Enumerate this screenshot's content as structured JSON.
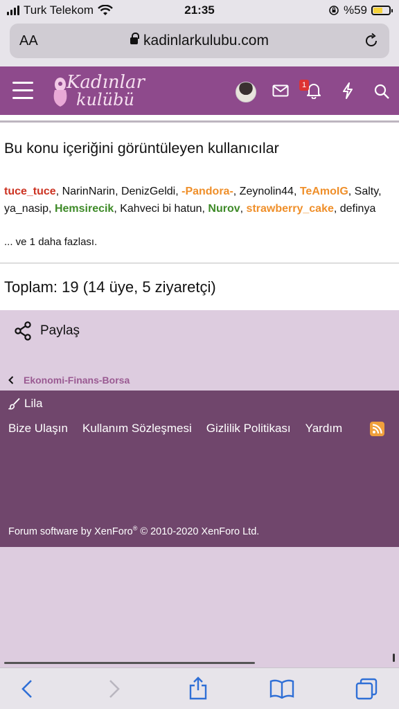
{
  "status_bar": {
    "carrier": "Turk Telekom",
    "time": "21:35",
    "battery": "%59"
  },
  "browser": {
    "aa_label": "AA",
    "url": "kadinlarkulubu.com"
  },
  "header": {
    "logo_line1": "Kadınlar",
    "logo_line2": "kulübü",
    "notification_count": "1"
  },
  "viewers": {
    "title": "Bu konu içeriğini görüntüleyen kullanıcılar",
    "users": [
      {
        "name": "tuce_tuce",
        "style": "red"
      },
      {
        "name": "NarinNarin",
        "style": "normal"
      },
      {
        "name": "DenizGeldi",
        "style": "normal"
      },
      {
        "name": "-Pandora-",
        "style": "orange"
      },
      {
        "name": "Zeynolin44",
        "style": "normal"
      },
      {
        "name": "TeAmoIG",
        "style": "orange"
      },
      {
        "name": "Salty",
        "style": "normal"
      },
      {
        "name": "ya_nasip",
        "style": "normal"
      },
      {
        "name": "Hemsirecik",
        "style": "green"
      },
      {
        "name": "Kahveci bi hatun",
        "style": "normal"
      },
      {
        "name": "Nurov",
        "style": "green"
      },
      {
        "name": "strawberry_cake",
        "style": "orange"
      },
      {
        "name": "definya",
        "style": "normal"
      }
    ],
    "more": "... ve 1 daha fazlası.",
    "total": "Toplam: 19 (14 üye, 5 ziyaretçi)"
  },
  "share_label": "Paylaş",
  "breadcrumb": "Ekonomi-Finans-Borsa",
  "footer": {
    "style_label": "Lila",
    "links": [
      "Bize Ulaşın",
      "Kullanım Sözleşmesi",
      "Gizlilik Politikası",
      "Yardım"
    ],
    "copyright_pre": "Forum software by XenForo",
    "copyright_reg": "®",
    "copyright_post": " © 2010-2020 XenForo Ltd."
  },
  "colors": {
    "header_bg": "#8e4a8c",
    "footer_bg": "#70466c",
    "page_bg": "#ddccdf",
    "user_red": "#cc3322",
    "user_orange": "#ef8f2a",
    "user_green": "#3e8a28",
    "ios_accent": "#2f6fd6"
  }
}
